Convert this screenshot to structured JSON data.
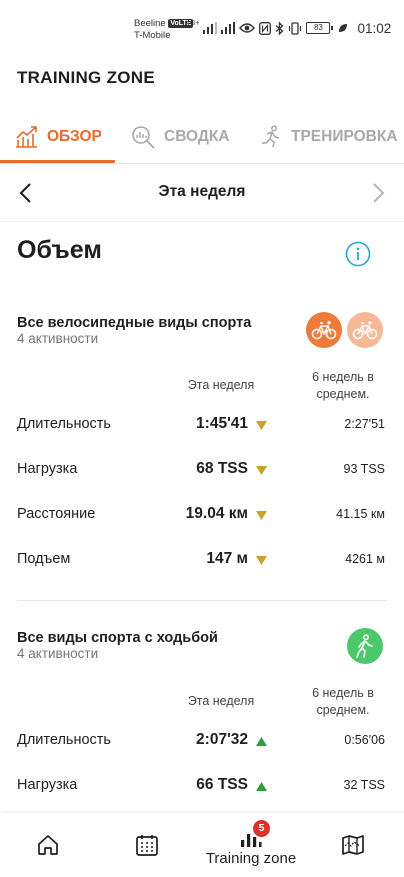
{
  "status_bar": {
    "carrier_1": "Beeline",
    "carrier_1_badge": "VoLTE",
    "carrier_2": "T-Mobile",
    "network": "4G+",
    "battery": "83",
    "time": "01:02"
  },
  "app": {
    "title": "TRAINING ZONE"
  },
  "tabs": [
    {
      "label": "ОБЗОР",
      "icon": "trend-chart-icon",
      "active": true
    },
    {
      "label": "СВОДКА",
      "icon": "magnifier-chart-icon",
      "active": false
    },
    {
      "label": "ТРЕНИРОВКА",
      "icon": "runner-icon",
      "active": false
    }
  ],
  "week_nav": {
    "label": "Эта неделя"
  },
  "section": {
    "title": "Объем"
  },
  "groups": [
    {
      "title": "Все велосипедные виды спорта",
      "subtitle": "4 активности",
      "col_current": "Эта неделя",
      "col_avg": "6 недель в среднем.",
      "rows": [
        {
          "label": "Длительность",
          "current": "1:45'41",
          "trend": "down",
          "avg": "2:27'51"
        },
        {
          "label": "Нагрузка",
          "current": "68 TSS",
          "trend": "down",
          "avg": "93 TSS"
        },
        {
          "label": "Расстояние",
          "current": "19.04 км",
          "trend": "down",
          "avg": "41.15 км"
        },
        {
          "label": "Подъем",
          "current": "147 м",
          "trend": "down",
          "avg": "4261 м"
        }
      ]
    },
    {
      "title": "Все виды спорта с ходьбой",
      "subtitle": "4 активности",
      "col_current": "Эта неделя",
      "col_avg": "6 недель в среднем.",
      "rows": [
        {
          "label": "Длительность",
          "current": "2:07'32",
          "trend": "up",
          "avg": "0:56'06"
        },
        {
          "label": "Нагрузка",
          "current": "66 TSS",
          "trend": "up",
          "avg": "32 TSS"
        }
      ]
    }
  ],
  "bottom_nav": {
    "items": [
      {
        "icon": "home-icon",
        "label": ""
      },
      {
        "icon": "calendar-icon",
        "label": ""
      },
      {
        "icon": "bar-chart-icon",
        "label": "Training zone",
        "badge": "5",
        "active": true
      },
      {
        "icon": "map-icon",
        "label": ""
      }
    ]
  },
  "colors": {
    "accent": "#e66b2c",
    "trend_down": "#c9a227",
    "trend_up": "#2e9b3f",
    "cycling_primary": "#f07a3a",
    "cycling_secondary": "#f6b896",
    "walking": "#4cc86a",
    "info": "#2aa6d6",
    "badge": "#d9342b"
  }
}
